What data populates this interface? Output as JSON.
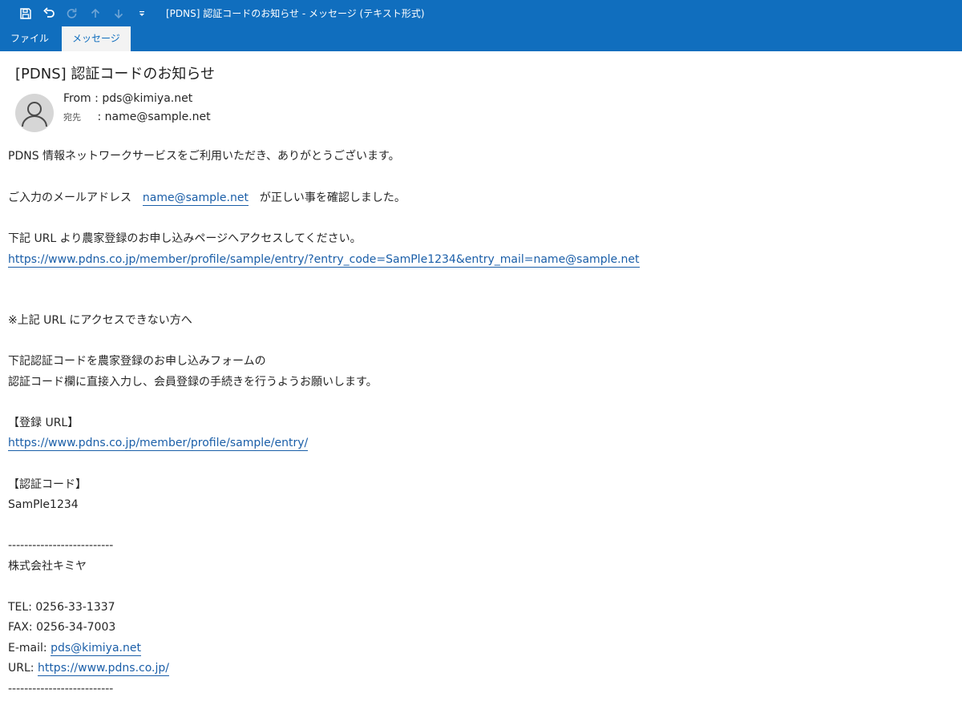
{
  "window": {
    "title": "[PDNS] 認証コードのお知らせ  -  メッセージ (テキスト形式)"
  },
  "quick_access": [
    {
      "icon": "save-icon"
    },
    {
      "icon": "undo-icon"
    },
    {
      "icon": "redo-icon"
    },
    {
      "icon": "arrow-up-icon"
    },
    {
      "icon": "arrow-down-icon"
    },
    {
      "icon": "customize-toolbar-icon"
    }
  ],
  "ribbon": {
    "tabs": [
      {
        "label": "ファイル",
        "active": false
      },
      {
        "label": "メッセージ",
        "active": true
      }
    ]
  },
  "message": {
    "subject": "[PDNS] 認証コードのお知らせ",
    "from_label": "From :",
    "from": "pds@kimiya.net",
    "to_label": "宛先",
    "to_sep": ":",
    "to": "name@sample.net"
  },
  "body": {
    "greeting": "PDNS 情報ネットワークサービスをご利用いただき、ありがとうございます。",
    "confirm_prefix": "ご入力のメールアドレス",
    "confirm_email": "name@sample.net",
    "confirm_suffix": "が正しい事を確認しました。",
    "access_text": "下記 URL より農家登録のお申し込みページへアクセスしてください。",
    "entry_link": "https://www.pdns.co.jp/member/profile/sample/entry/?entry_code=SamPle1234&entry_mail=name@sample.net",
    "note": "※上記 URL にアクセスできない方へ",
    "instruction_1": "下記認証コードを農家登録のお申し込みフォームの",
    "instruction_2": "認証コード欄に直接入力し、会員登録の手続きを行うようお願いします。",
    "reg_url_heading": "【登録 URL】",
    "reg_url": "https://www.pdns.co.jp/member/profile/sample/entry/",
    "code_heading": "【認証コード】",
    "code": "SamPle1234",
    "separator": "--------------------------",
    "company": "株式会社キミヤ",
    "tel": "TEL: 0256-33-1337",
    "fax": "FAX: 0256-34-7003",
    "email_label": "E-mail:",
    "email": "pds@kimiya.net",
    "url_label": "URL:",
    "url": "https://www.pdns.co.jp/"
  },
  "colors": {
    "titlebar": "#106ebe",
    "link": "#1a5ea8"
  }
}
